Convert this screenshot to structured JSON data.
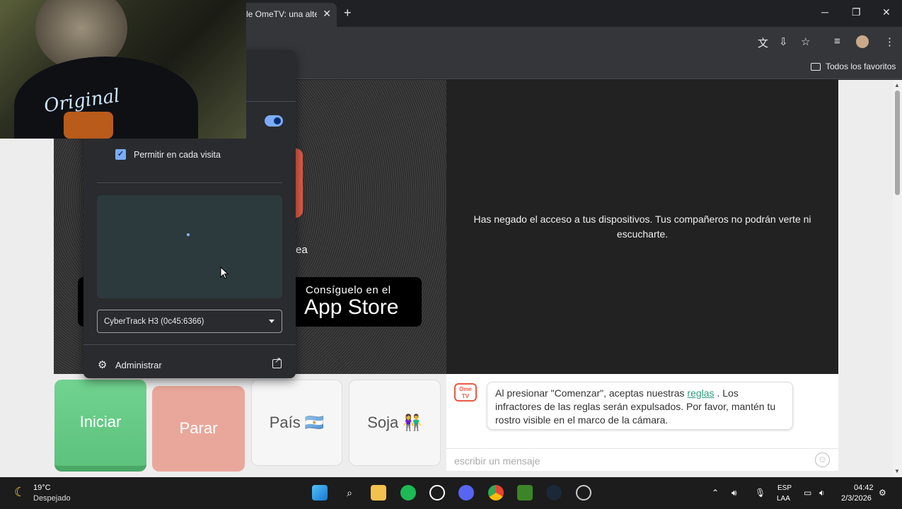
{
  "browser": {
    "tab_title": "le OmeTV: una alter",
    "tab_close": "✕",
    "new_tab": "+",
    "window": {
      "minimize": "─",
      "restore": "❐",
      "close": "✕"
    },
    "bookmarks_folder": "Todos los favoritos"
  },
  "permission_popup": {
    "close": "✕",
    "checkbox_label": "Permitir en cada visita",
    "camera_select_value": "CyberTrack H3 (0c45:6366)",
    "manage_label": "Administrar"
  },
  "page": {
    "denied_message": "Has negado el acceso a tus dispositivos. Tus compañeros no podrán verte ni escucharte.",
    "partial_text": "ea",
    "appstore": {
      "line1": "Consíguelo en el",
      "line2": "App Store"
    },
    "buttons": {
      "start": "Iniciar",
      "stop": "Parar",
      "country": "País 🇦🇷",
      "gender": "Soja 👫"
    },
    "chat": {
      "logo_line1": "Ome",
      "logo_line2": "TV",
      "msg_before": "Al presionar \"Comenzar\", aceptas nuestras ",
      "msg_link": "reglas",
      "msg_after": " . Los infractores de las reglas serán expulsados. Por favor, mantén tu rostro visible en el marco de la cámara.",
      "input_placeholder": "escribir un mensaje"
    }
  },
  "webcam": {
    "shirt_text": "Original"
  },
  "taskbar": {
    "weather_temp": "19°C",
    "weather_desc": "Despejado",
    "lang_line1": "ESP",
    "lang_line2": "LAA",
    "time": "04:42",
    "date": "2/3/2026"
  },
  "colors": {
    "accent_green": "#5cc27d",
    "stop_red": "#e9a79b",
    "link": "#2f9e78",
    "toggle_blue": "#7cacf8"
  }
}
